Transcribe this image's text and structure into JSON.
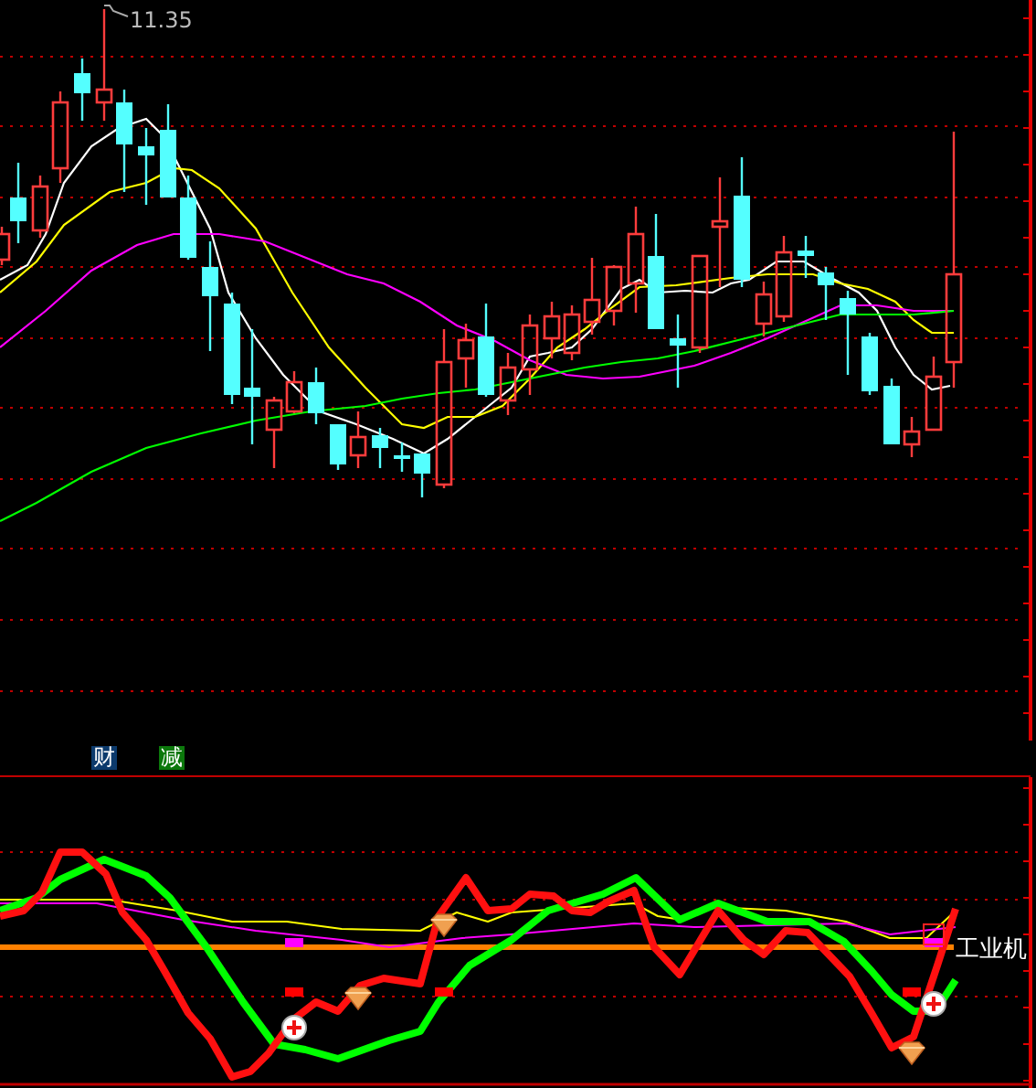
{
  "price_panel": {
    "high_label": "11.35"
  },
  "indicator_panel": {
    "tags": [
      {
        "text": "财",
        "color": "#0c3a6c"
      },
      {
        "text": "减",
        "color": "#0c780c"
      }
    ],
    "sector_label": "工业机"
  }
}
